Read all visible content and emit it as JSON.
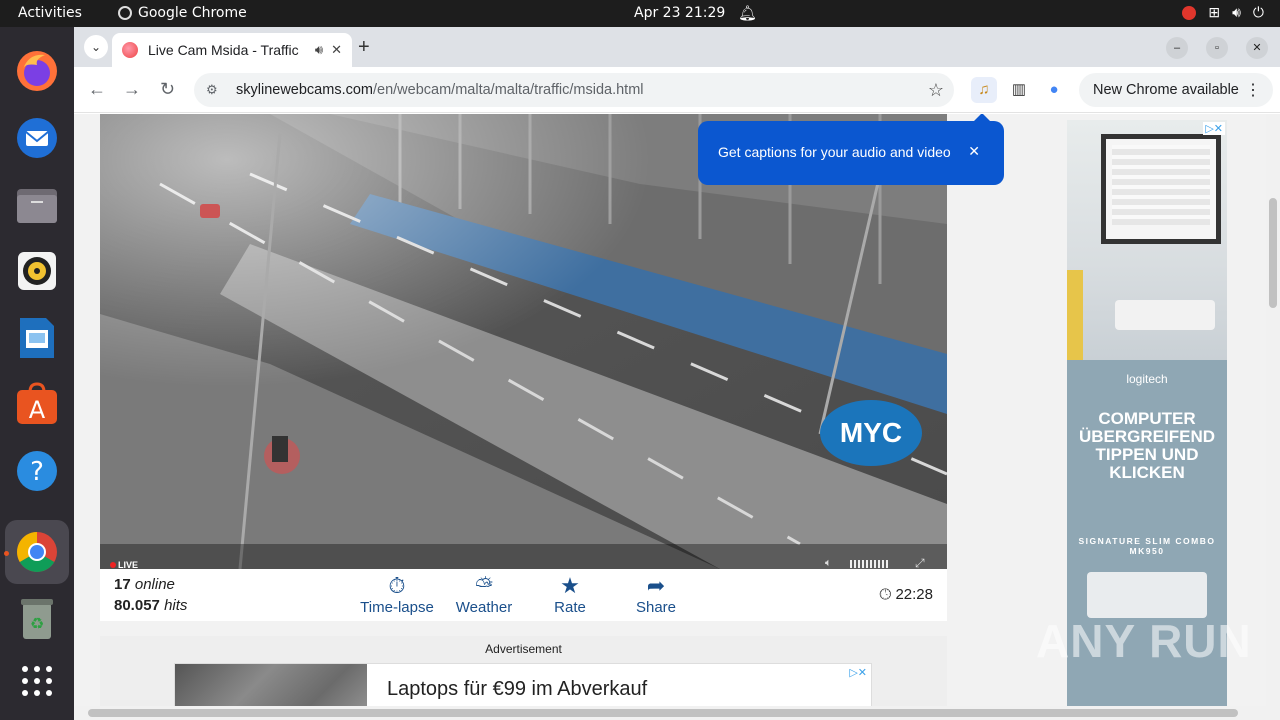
{
  "topbar": {
    "activities": "Activities",
    "app_name": "Google Chrome",
    "clock": "Apr 23  21:29"
  },
  "dock": {
    "apps": [
      "firefox-icon",
      "thunderbird-icon",
      "files-icon",
      "rhythmbox-icon",
      "writer-icon",
      "app-center-icon",
      "help-icon",
      "chrome-icon",
      "trash-icon",
      "app-grid-icon"
    ]
  },
  "browser": {
    "tab_title": "Live Cam Msida - Traffic",
    "url_host": "skylinewebcams.com",
    "url_path": "/en/webcam/malta/malta/traffic/msida.html",
    "new_chrome": "New Chrome available"
  },
  "tooltip": {
    "text": "Get captions for your audio and video"
  },
  "player": {
    "live_label": "LIVE",
    "watermark": "MYC",
    "online_count": "17",
    "online_label": "online",
    "hits_count": "80.057",
    "hits_label": "hits",
    "actions": [
      {
        "label": "Time-lapse",
        "icon": "timelapse-icon"
      },
      {
        "label": "Weather",
        "icon": "weather-icon"
      },
      {
        "label": "Rate",
        "icon": "star-icon"
      },
      {
        "label": "Share",
        "icon": "share-icon"
      }
    ],
    "time": "22:28"
  },
  "ads": {
    "label": "Advertisement",
    "banner_text": "Laptops für €99 im Abverkauf",
    "side_logo": "logitech",
    "side_headline": "COMPUTER ÜBERGREIFEND TIPPEN UND KLICKEN",
    "side_product": "SIGNATURE SLIM COMBO MK950"
  },
  "overlay": {
    "watermark": "ANY RUN"
  }
}
